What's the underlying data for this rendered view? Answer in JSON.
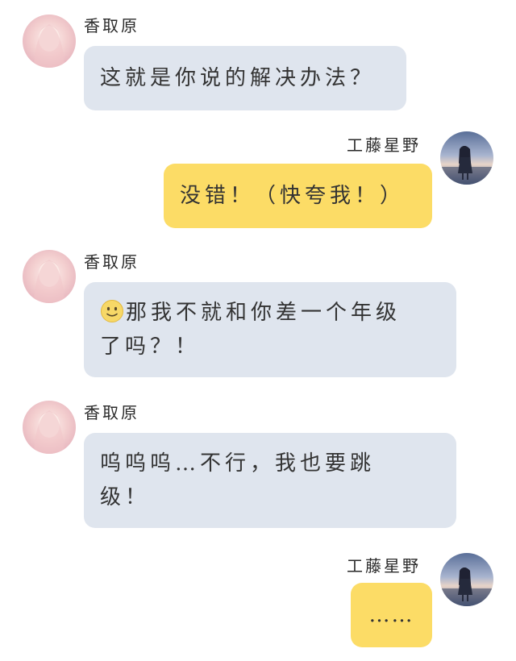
{
  "messages": [
    {
      "side": "left",
      "sender": "香取原",
      "text": "这就是你说的解决办法？"
    },
    {
      "side": "right",
      "sender": "工藤星野",
      "text": "没错！（快夸我！）"
    },
    {
      "side": "left",
      "sender": "香取原",
      "emoji": "slightly-smiling-face-icon",
      "line1": "那我不就和你差一个年级",
      "line2": "了吗？！"
    },
    {
      "side": "left",
      "sender": "香取原",
      "line1": "呜呜呜…不行，我也要跳",
      "line2": "级！"
    },
    {
      "side": "right",
      "sender": "工藤星野",
      "text": "……"
    }
  ],
  "colors": {
    "left_bubble": "#dfe5ee",
    "right_bubble": "#fcdc66",
    "text": "#333333",
    "background": "#ffffff"
  }
}
